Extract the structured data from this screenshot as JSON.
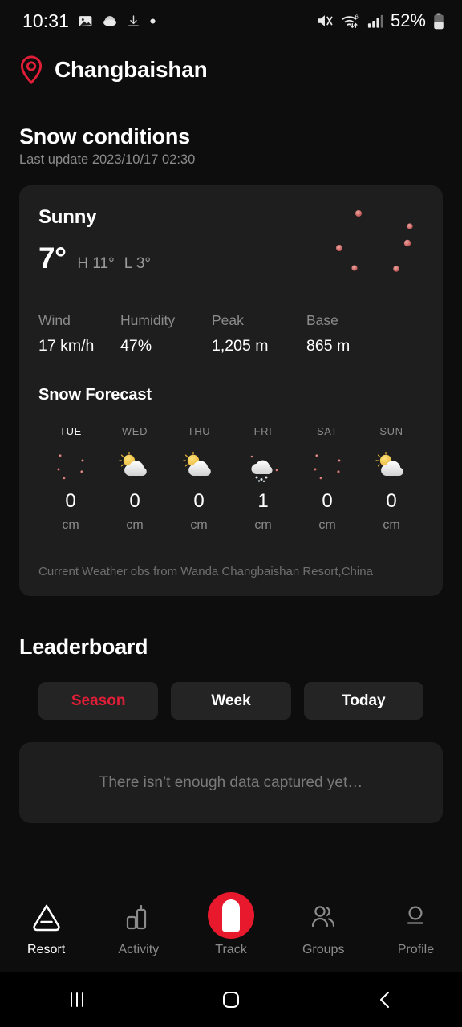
{
  "statusbar": {
    "clock": "10:31",
    "battery_pct": "52%",
    "left_icons": [
      "image-icon",
      "cloud-icon",
      "download-icon",
      "dot-icon"
    ],
    "right_icons": [
      "mute-icon",
      "wifi6-icon",
      "signal-icon",
      "battery-icon"
    ]
  },
  "header": {
    "location_icon": "location-pin-icon",
    "location": "Changbaishan"
  },
  "snow_conditions": {
    "title": "Snow conditions",
    "last_update": "Last update 2023/10/17 02:30",
    "condition": "Sunny",
    "temp": "7°",
    "high": "H 11°",
    "low": "L 3°",
    "icon": "crescent-moon-icon",
    "stats": [
      {
        "label": "Wind",
        "value": "17 km/h"
      },
      {
        "label": "Humidity",
        "value": "47%"
      },
      {
        "label": "Peak",
        "value": "1,205 m"
      },
      {
        "label": "Base",
        "value": "865 m"
      }
    ],
    "forecast_title": "Snow Forecast",
    "forecast": [
      {
        "day": "TUE",
        "icon": "moon-icon",
        "value": "0",
        "unit": "cm",
        "active": true
      },
      {
        "day": "WED",
        "icon": "sun-cloud-icon",
        "value": "0",
        "unit": "cm",
        "active": false
      },
      {
        "day": "THU",
        "icon": "sun-cloud-icon",
        "value": "0",
        "unit": "cm",
        "active": false
      },
      {
        "day": "FRI",
        "icon": "snow-cloud-icon",
        "value": "1",
        "unit": "cm",
        "active": false
      },
      {
        "day": "SAT",
        "icon": "moon-icon",
        "value": "0",
        "unit": "cm",
        "active": false
      },
      {
        "day": "SUN",
        "icon": "sun-cloud-icon",
        "value": "0",
        "unit": "cm",
        "active": false
      }
    ],
    "attribution": "Current Weather obs from Wanda Changbaishan Resort,China"
  },
  "leaderboard": {
    "title": "Leaderboard",
    "tabs": [
      {
        "label": "Season",
        "active": true
      },
      {
        "label": "Week",
        "active": false
      },
      {
        "label": "Today",
        "active": false
      }
    ],
    "empty_message": "There isn’t enough data captured yet…"
  },
  "bottom_nav": [
    {
      "label": "Resort",
      "icon": "mountain-icon",
      "active": true
    },
    {
      "label": "Activity",
      "icon": "barchart-icon",
      "active": false
    },
    {
      "label": "Track",
      "icon": "track-icon",
      "active": false
    },
    {
      "label": "Groups",
      "icon": "groups-icon",
      "active": false
    },
    {
      "label": "Profile",
      "icon": "profile-icon",
      "active": false
    }
  ],
  "android_nav": [
    {
      "icon": "recents-icon"
    },
    {
      "icon": "home-icon"
    },
    {
      "icon": "back-icon"
    }
  ],
  "colors": {
    "accent_red": "#e01e37",
    "track_red": "#e8192c",
    "page_bg": "#0d0d0d",
    "card_bg": "#1e1e1e",
    "muted_text": "#8b8b8b"
  }
}
